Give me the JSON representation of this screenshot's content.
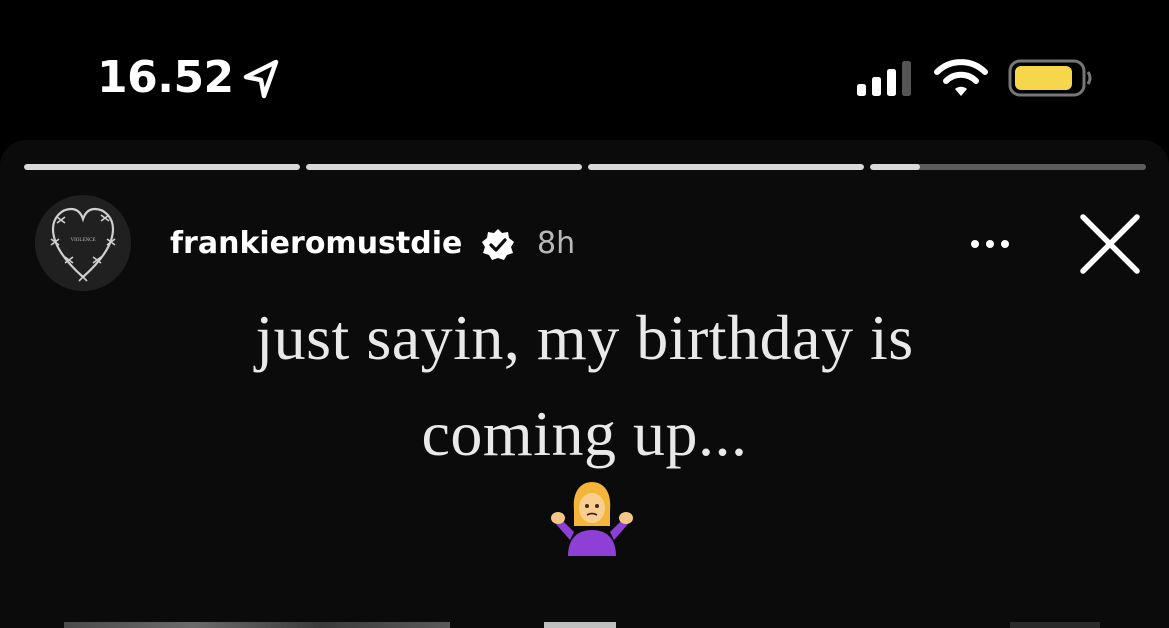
{
  "status_bar": {
    "time": "16.52",
    "location_icon": "location-arrow-icon",
    "signal_icon": "cellular-signal-icon",
    "wifi_icon": "wifi-icon",
    "battery_icon": "battery-icon",
    "battery_color": "#f6d64b"
  },
  "story": {
    "progress_segments": [
      {
        "fill": 1.0
      },
      {
        "fill": 1.0
      },
      {
        "fill": 1.0
      },
      {
        "fill": 0.18
      }
    ],
    "username": "frankieromustdie",
    "verified_icon": "verified-badge-icon",
    "time_ago": "8h",
    "avatar_icon": "barbed-wire-heart-icon",
    "avatar_text": "VIOLENCE",
    "text_lines": [
      "just sayin, my birthday is",
      "coming up..."
    ],
    "emoji_icon": "person-shrugging-emoji-icon",
    "more_icon": "more-options-icon",
    "close_icon": "close-icon"
  }
}
